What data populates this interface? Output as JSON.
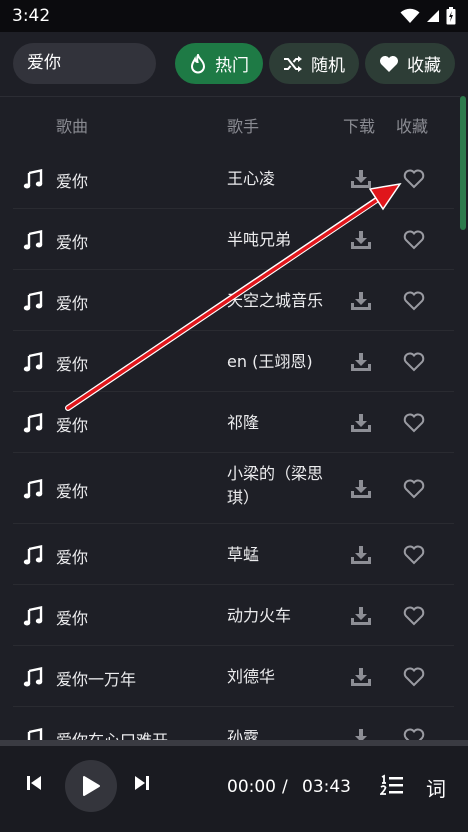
{
  "status_bar": {
    "time": "3:42"
  },
  "search": {
    "value": "爱你"
  },
  "chips": {
    "hot": "热门",
    "random": "随机",
    "favorites": "收藏"
  },
  "columns": {
    "song": "歌曲",
    "artist": "歌手",
    "download": "下载",
    "favorite": "收藏"
  },
  "songs": [
    {
      "title": "爱你",
      "artist": "王心凌"
    },
    {
      "title": "爱你",
      "artist": "半吨兄弟"
    },
    {
      "title": "爱你",
      "artist": "天空之城音乐"
    },
    {
      "title": "爱你",
      "artist": "en (王翊恩)"
    },
    {
      "title": "爱你",
      "artist": "祁隆"
    },
    {
      "title": "爱你",
      "artist": "小梁的（梁思琪）"
    },
    {
      "title": "爱你",
      "artist": "草蜢"
    },
    {
      "title": "爱你",
      "artist": "动力火车"
    },
    {
      "title": "爱你一万年",
      "artist": "刘德华"
    },
    {
      "title": "爱你在心口难开",
      "artist": "孙露"
    }
  ],
  "player": {
    "current_time": "00:00",
    "separator": "/",
    "total_time": "03:43",
    "lyrics_label": "词",
    "progress": 0
  },
  "colors": {
    "accent": "#1e7a45",
    "annotation_arrow": "#e0161b",
    "background": "#1e1f26"
  }
}
